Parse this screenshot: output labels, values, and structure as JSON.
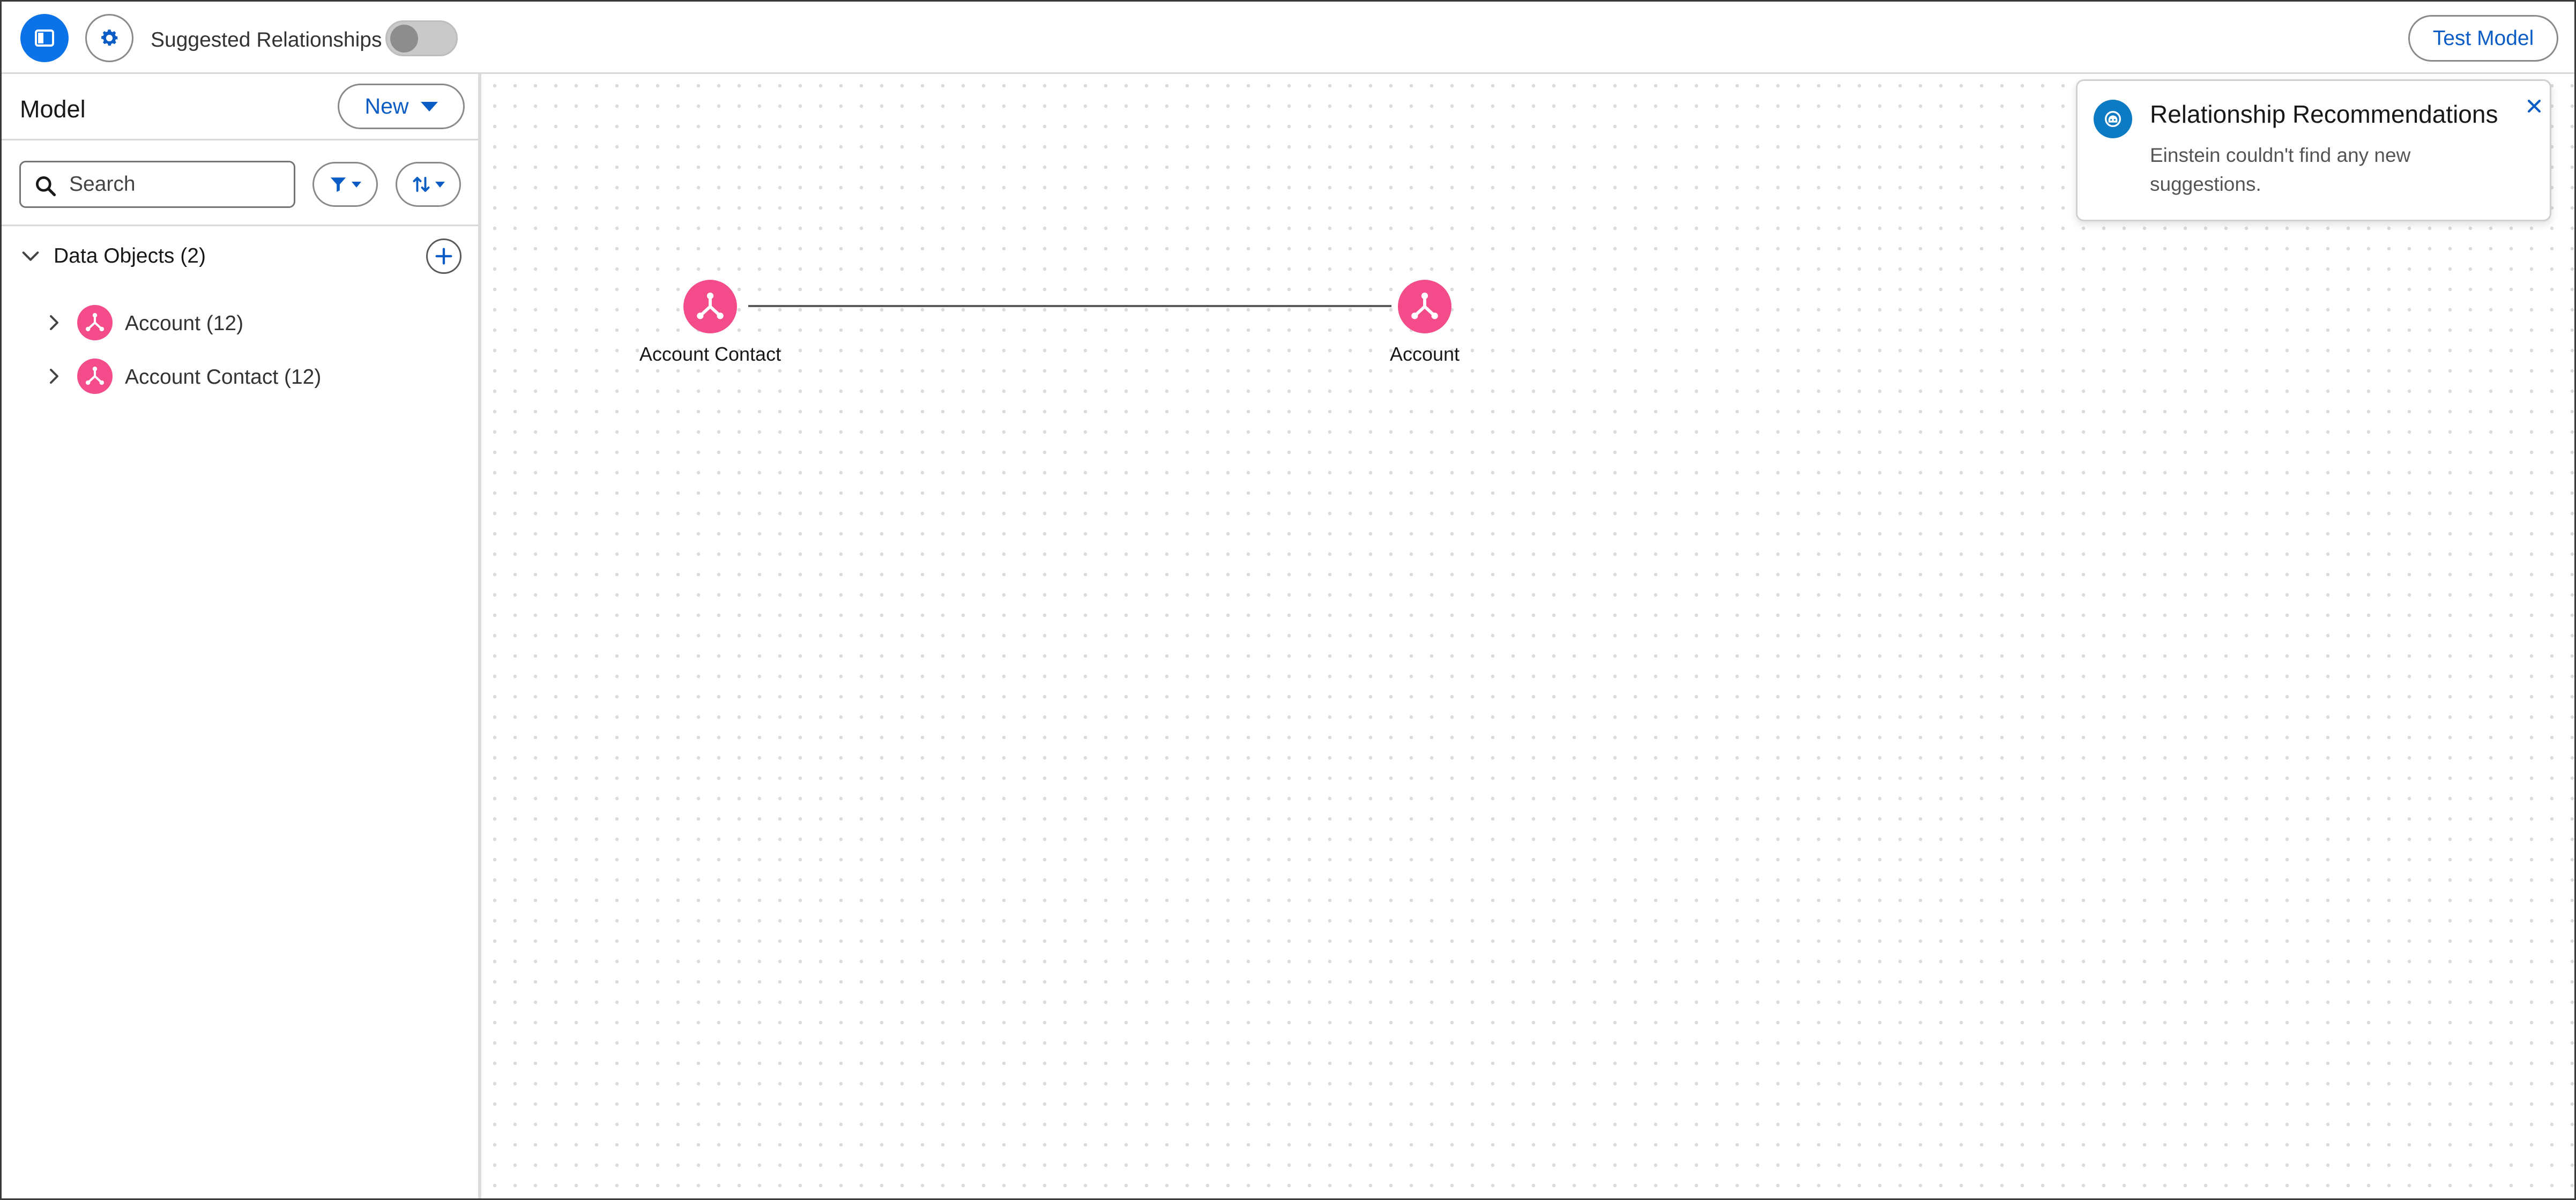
{
  "topbar": {
    "toggle_label": "Suggested Relationships",
    "toggle_on": false,
    "test_model_label": "Test Model"
  },
  "sidebar": {
    "title": "Model",
    "new_label": "New",
    "search": {
      "placeholder": "Search",
      "value": ""
    },
    "section": {
      "label": "Data Objects (2)"
    },
    "items": [
      {
        "label": "Account (12)"
      },
      {
        "label": "Account Contact (12)"
      }
    ]
  },
  "canvas": {
    "nodes": [
      {
        "label": "Account Contact"
      },
      {
        "label": "Account"
      }
    ]
  },
  "toast": {
    "title": "Relationship Recommendations",
    "body": "Einstein couldn't find any new suggestions."
  },
  "colors": {
    "accent": "#0b72e7",
    "link": "#0b5cc4",
    "object_icon": "#f44c8a",
    "einstein_icon": "#0d7ac4"
  },
  "icons": {
    "panel_button": "panel-toggle-icon",
    "settings_button": "gear-icon",
    "search": "search-icon",
    "filter": "filter-icon",
    "sort": "sort-icon",
    "add": "plus-icon",
    "object": "data-object-icon",
    "toast": "einstein-icon",
    "close": "close-icon"
  }
}
